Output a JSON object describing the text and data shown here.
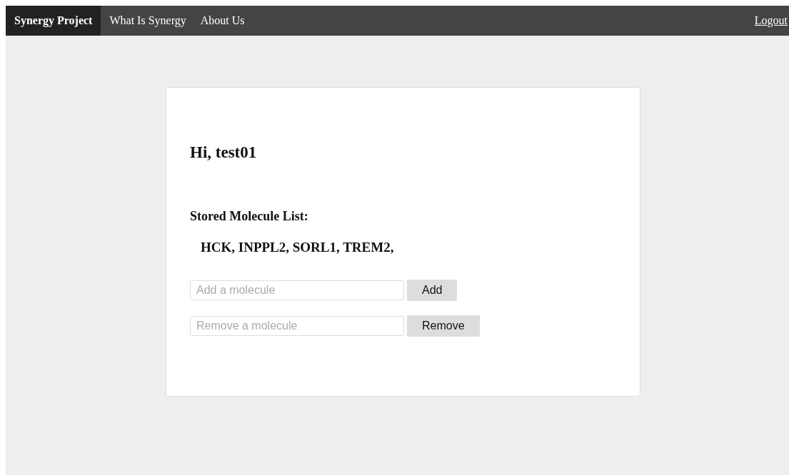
{
  "navbar": {
    "items": [
      {
        "label": "Synergy Project",
        "selected": true
      },
      {
        "label": "What Is Synergy",
        "selected": false
      },
      {
        "label": "About Us",
        "selected": false
      }
    ],
    "logout": "Logout"
  },
  "card": {
    "greeting": "Hi, test01",
    "list_title": "Stored Molecule List:",
    "molecules": "HCK, INPPL2, SORL1, TREM2,",
    "forms": [
      {
        "placeholder": "Add a molecule",
        "button": "Add"
      },
      {
        "placeholder": "Remove a molecule",
        "button": "Remove"
      }
    ]
  }
}
